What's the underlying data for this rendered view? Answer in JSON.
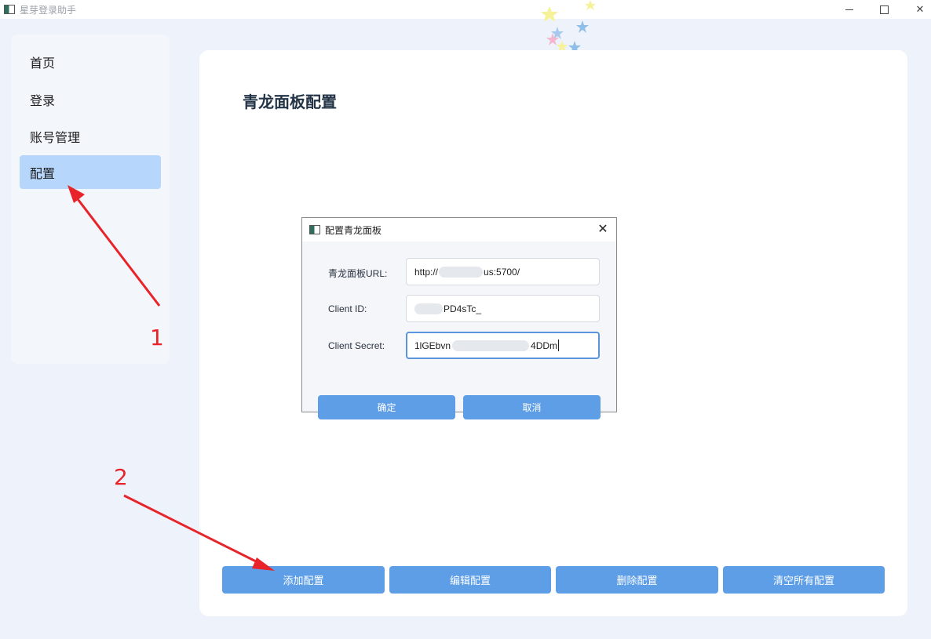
{
  "window": {
    "title": "星芽登录助手",
    "controls": [
      "minimize",
      "maximize",
      "close"
    ]
  },
  "sidebar": {
    "items": [
      {
        "label": "首页",
        "active": false
      },
      {
        "label": "登录",
        "active": false
      },
      {
        "label": "账号管理",
        "active": false
      },
      {
        "label": "配置",
        "active": true
      }
    ]
  },
  "main": {
    "title": "青龙面板配置",
    "buttons": [
      {
        "label": "添加配置"
      },
      {
        "label": "编辑配置"
      },
      {
        "label": "删除配置"
      },
      {
        "label": "清空所有配置"
      }
    ]
  },
  "dialog": {
    "title": "配置青龙面板",
    "close_glyph": "✕",
    "fields": [
      {
        "label": "青龙面板URL:",
        "value_prefix": "http://",
        "value_suffix": "us:5700/"
      },
      {
        "label": "Client ID:",
        "value_prefix": "",
        "value_suffix": "PD4sTc_"
      },
      {
        "label": "Client Secret:",
        "value_prefix": "1lGEbvn",
        "value_suffix": "4DDm",
        "focused": true
      }
    ],
    "confirm_label": "确定",
    "cancel_label": "取消"
  },
  "annotations": {
    "marker1": "1",
    "marker2": "2",
    "arrow_color": "#e8242a"
  },
  "colors": {
    "accent_button": "#5d9ee6",
    "active_nav": "#b7d6fb",
    "background": "#eef3fb"
  }
}
